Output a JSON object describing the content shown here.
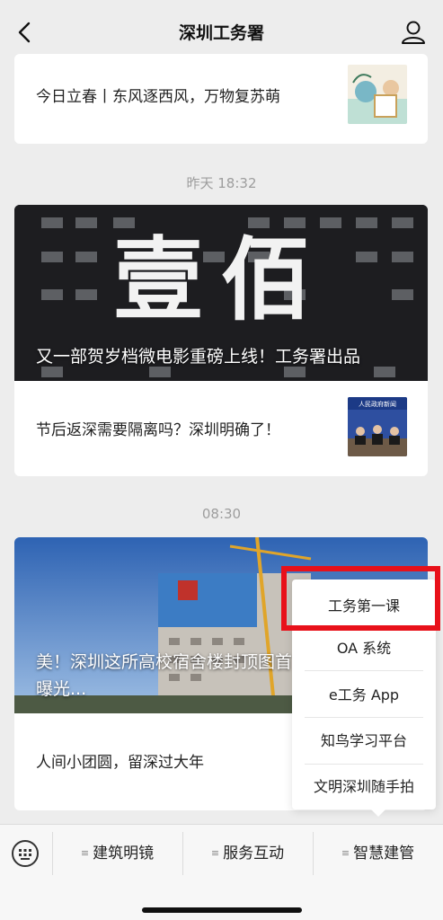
{
  "nav": {
    "title": "深圳工务署"
  },
  "messages": [
    {
      "timestamp": "",
      "articles": [
        {
          "title": "今日立春丨东风逐西风，万物复苏萌"
        }
      ]
    },
    {
      "timestamp": "昨天 18:32",
      "cover": {
        "title": "又一部贺岁档微电影重磅上线！工务署出品",
        "big_text": "壹佰"
      },
      "articles": [
        {
          "title": "节后返深需要隔离吗？深圳明确了！"
        }
      ]
    },
    {
      "timestamp": "08:30",
      "cover": {
        "title": "美！深圳这所高校宿舍楼封顶图首曝光..."
      },
      "articles": [
        {
          "title": "人间小团圆，留深过大年"
        }
      ]
    }
  ],
  "submenu": {
    "items": [
      "工务第一课",
      "OA 系统",
      "e工务 App",
      "知鸟学习平台",
      "文明深圳随手拍"
    ],
    "highlight_color": "#e8111a"
  },
  "bottom_tabs": [
    "建筑明镜",
    "服务互动",
    "智慧建管"
  ],
  "colors": {
    "background": "#ededed",
    "card": "#ffffff",
    "timestamp": "#9d9d9d"
  }
}
